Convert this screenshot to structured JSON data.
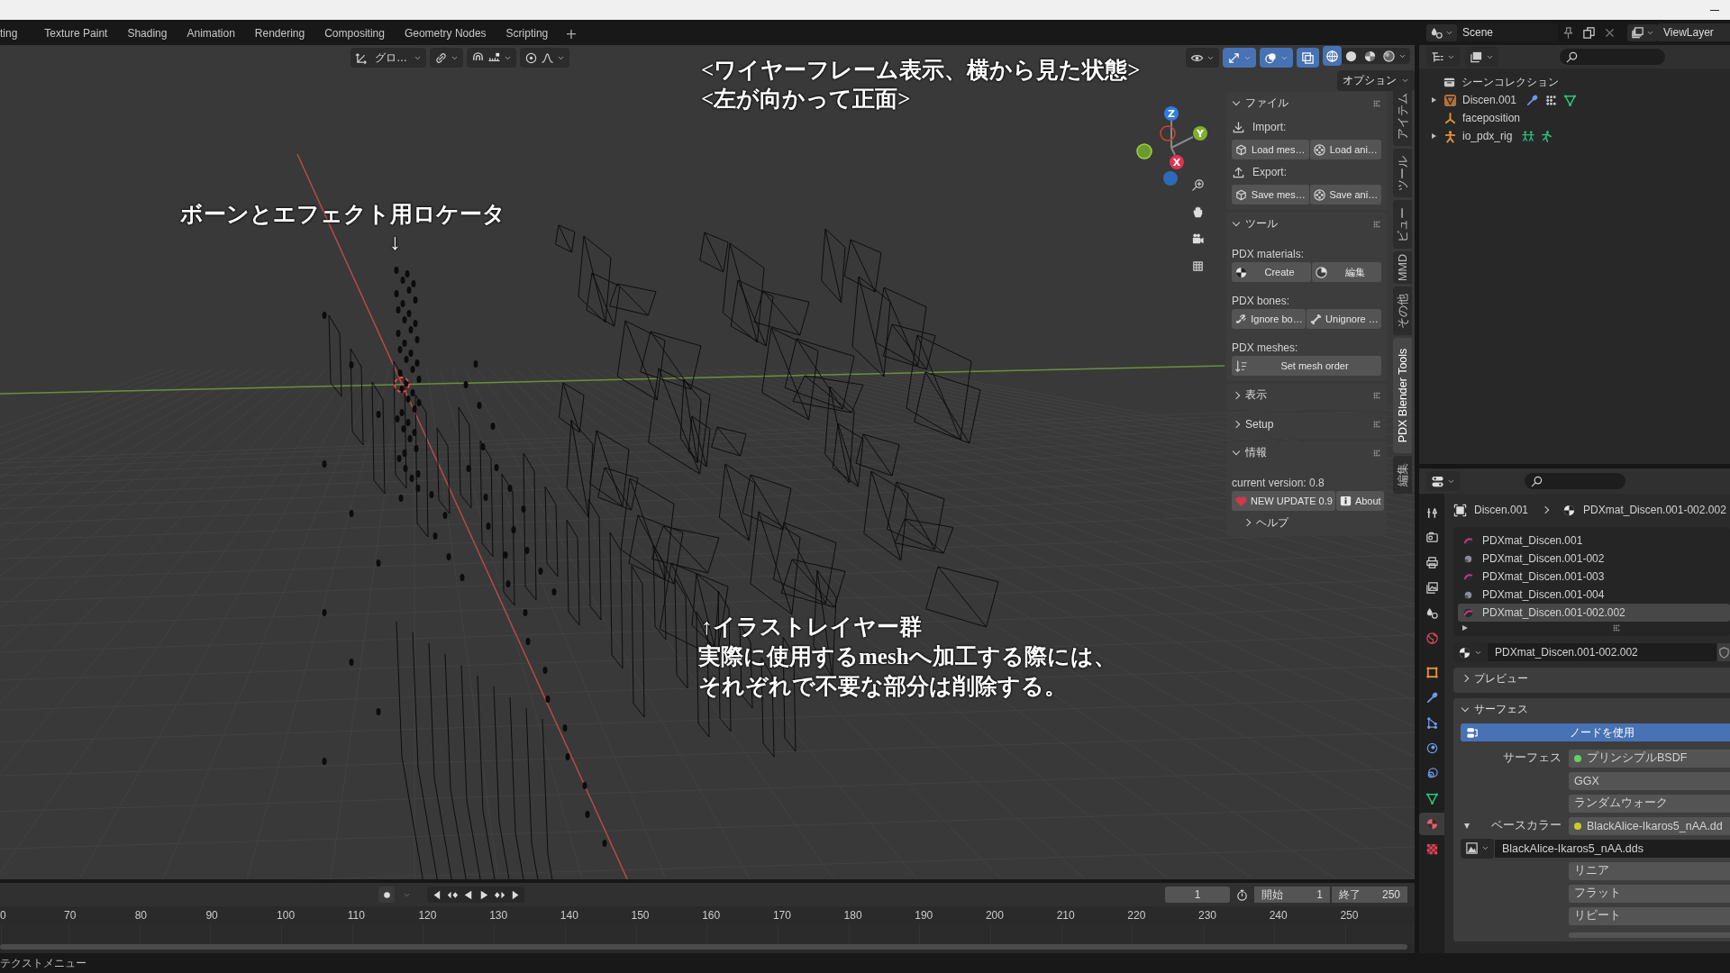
{
  "workspace_tabs": [
    {
      "label": "ting",
      "selected": false
    },
    {
      "label": "Texture Paint",
      "selected": false
    },
    {
      "label": "Shading",
      "selected": false
    },
    {
      "label": "Animation",
      "selected": false
    },
    {
      "label": "Rendering",
      "selected": false
    },
    {
      "label": "Compositing",
      "selected": false
    },
    {
      "label": "Geometry Nodes",
      "selected": false
    },
    {
      "label": "Scripting",
      "selected": false
    }
  ],
  "add_workspace": "+",
  "scene": "Scene",
  "view_layer": "ViewLayer",
  "viewport": {
    "orientation": "グロ…",
    "options": "オプション",
    "gizmo_axes": [
      "Z",
      "Y",
      "X"
    ],
    "toggles": {
      "gizmos": true,
      "overlays": true,
      "xray": true
    },
    "shading": [
      {
        "selected": true
      },
      {
        "selected": false
      },
      {
        "selected": false
      },
      {
        "selected": false
      }
    ],
    "annotations": [
      "<ワイヤーフレーム表示、横から見た状態>",
      "<左が向かって正面>",
      "ボーンとエフェクト用ロケータ",
      "↓",
      "↑イラストレイヤー群",
      "実際に使用するmeshへ加工する際には、",
      "それぞれで不要な部分は削除する。"
    ]
  },
  "sidebar": {
    "tabs": [
      {
        "label": "アイテム",
        "selected": false
      },
      {
        "label": "ツール",
        "selected": false
      },
      {
        "label": "ビュー",
        "selected": false
      },
      {
        "label": "MMD",
        "selected": false
      },
      {
        "label": "その他",
        "selected": false
      },
      {
        "label": "PDX Blender Tools",
        "selected": true
      },
      {
        "label": "編集",
        "selected": false
      }
    ],
    "panels": [
      {
        "title": "ファイル",
        "expanded": true,
        "rows": [
          {
            "kind": "heading",
            "text": "Import:"
          },
          {
            "kind": "buttons",
            "buttons": [
              "Load mes…",
              "Load ani…"
            ]
          },
          {
            "kind": "heading",
            "text": "Export:"
          },
          {
            "kind": "buttons",
            "buttons": [
              "Save mes…",
              "Save ani…"
            ]
          }
        ]
      },
      {
        "title": "ツール",
        "expanded": true,
        "rows": [
          {
            "kind": "label",
            "text": "PDX materials:"
          },
          {
            "kind": "buttons",
            "buttons": [
              "Create",
              "編集"
            ]
          },
          {
            "kind": "label",
            "text": "PDX bones:"
          },
          {
            "kind": "buttons",
            "buttons": [
              "Ignore bo…",
              "Unignore …"
            ]
          },
          {
            "kind": "label",
            "text": "PDX meshes:"
          },
          {
            "kind": "buttons",
            "buttons": [
              "Set mesh order"
            ]
          }
        ]
      },
      {
        "title": "表示",
        "expanded": false
      },
      {
        "title": "Setup",
        "expanded": false
      },
      {
        "title": "情報",
        "expanded": true,
        "rows": [
          {
            "kind": "label",
            "text": "current version: 0.8"
          },
          {
            "kind": "buttons",
            "buttons": [
              "NEW UPDATE 0.9",
              "About"
            ]
          },
          {
            "kind": "subpanel",
            "text": "ヘルプ",
            "expanded": false
          }
        ]
      }
    ]
  },
  "outliner": {
    "root": "シーンコレクション",
    "children": [
      {
        "label": "Discen.001",
        "kind": "mesh",
        "has_children": true,
        "expanded": false
      },
      {
        "label": "faceposition",
        "kind": "empty",
        "has_children": false,
        "expanded": false
      },
      {
        "label": "io_pdx_rig",
        "kind": "armature",
        "has_children": true,
        "expanded": false
      }
    ]
  },
  "properties": {
    "tabs": [
      {
        "selected": false
      },
      {
        "selected": false
      },
      {
        "selected": false
      },
      {
        "selected": false
      },
      {
        "selected": false
      },
      {
        "selected": false
      },
      {
        "selected": false
      },
      {
        "selected": false
      },
      {
        "selected": false
      },
      {
        "selected": false
      },
      {
        "selected": false
      },
      {
        "selected": false
      },
      {
        "selected": true
      },
      {
        "selected": false
      }
    ],
    "breadcrumb": [
      "Discen.001",
      "PDXmat_Discen.001-002.002"
    ],
    "slots": [
      {
        "name": "PDXmat_Discen.001",
        "selected": false
      },
      {
        "name": "PDXmat_Discen.001-002",
        "selected": false
      },
      {
        "name": "PDXmat_Discen.001-003",
        "selected": false
      },
      {
        "name": "PDXmat_Discen.001-004",
        "selected": false
      },
      {
        "name": "PDXmat_Discen.001-002.002",
        "selected": true
      }
    ],
    "material": "PDXmat_Discen.001-002.002",
    "panels": [
      {
        "title": "プレビュー",
        "expanded": false
      },
      {
        "title": "サーフェス",
        "expanded": true
      }
    ],
    "use_nodes": "ノードを使用",
    "fields": [
      {
        "kind": "socket",
        "label": "サーフェス",
        "value": "プリンシプルBSDF",
        "color": "#5fd35f"
      },
      {
        "kind": "select",
        "value": "GGX"
      },
      {
        "kind": "select",
        "value": "ランダムウォーク"
      },
      {
        "kind": "socket",
        "label": "ベースカラー",
        "value": "BlackAlice-Ikaros5_nAA.dd",
        "color": "#c9c92e",
        "expanded": true
      },
      {
        "kind": "image",
        "value": "BlackAlice-Ikaros5_nAA.dds"
      },
      {
        "kind": "select",
        "value": "リニア"
      },
      {
        "kind": "select",
        "value": "フラット"
      },
      {
        "kind": "select",
        "value": "リピート"
      }
    ]
  },
  "timeline": {
    "frame": "1",
    "start_label": "開始",
    "start": "1",
    "end_label": "終了",
    "end": "250",
    "ruler": [
      "0",
      "70",
      "80",
      "90",
      "100",
      "110",
      "120",
      "130",
      "140",
      "150",
      "160",
      "170",
      "180",
      "190",
      "200",
      "210",
      "220",
      "230",
      "240",
      "250"
    ]
  },
  "status_bar": "テクストメニュー"
}
